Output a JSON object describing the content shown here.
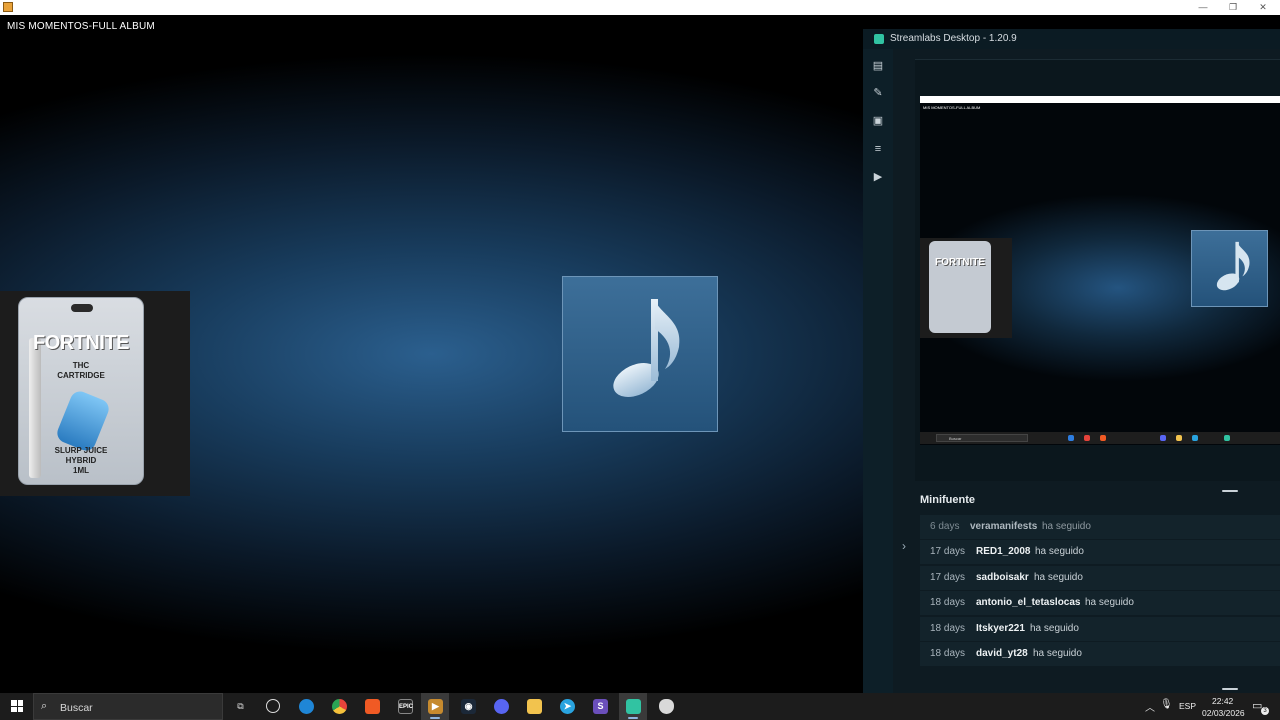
{
  "player": {
    "title": "MIS MOMENTOS-FULL ALBUM",
    "cover_text": {
      "brand": "FORTNITE",
      "line1": "THC",
      "line2": "CARTRIDGE",
      "line3": "SLURP JUICE",
      "line4": "HYBRID",
      "line5": "1ML"
    }
  },
  "window_controls": {
    "minimize": "—",
    "restore": "❐",
    "close": "✕"
  },
  "streamlabs": {
    "title": "Streamlabs Desktop - 1.20.9",
    "preview": {
      "mini_title": "MIS MOMENTOS-FULL ALBUM",
      "mini_brand": "FORTNITE",
      "mini_search": "Buscar"
    },
    "minifeed": {
      "title": "Minifuente",
      "items": [
        {
          "age": "6 days",
          "user": "veramanifests",
          "action": "ha seguido"
        },
        {
          "age": "17 days",
          "user": "RED1_2008",
          "action": "ha seguido"
        },
        {
          "age": "17 days",
          "user": "sadboisakr",
          "action": "ha seguido"
        },
        {
          "age": "18 days",
          "user": "antonio_el_tetaslocas",
          "action": "ha seguido"
        },
        {
          "age": "18 days",
          "user": "Itskyer221",
          "action": "ha seguido"
        },
        {
          "age": "18 days",
          "user": "david_yt28",
          "action": "ha seguido"
        }
      ]
    }
  },
  "taskbar": {
    "search_placeholder": "Buscar",
    "epic_label": "EPIC",
    "tray_language": "ESP",
    "time": "22:42",
    "date": "02/03/2026",
    "notification_count": "3"
  },
  "colors": {
    "streamlabs_accent": "#31c3a2",
    "taskbar_bg": "#1c1c1c"
  }
}
